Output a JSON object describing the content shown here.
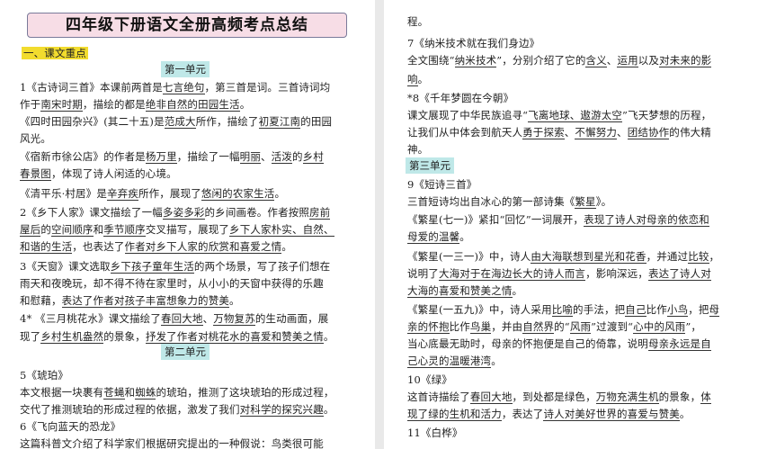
{
  "left_page": {
    "title": "四年级下册语文全册高频考点总结",
    "section_heading": "一、课文重点",
    "unit1": "第一单元",
    "unit2": "第二单元",
    "lines": [
      [
        {
          "t": "1《古诗词三首》本课前两首是"
        },
        {
          "t": "七言绝句",
          "u": true
        },
        {
          "t": "，第三首是词。三首诗词均"
        }
      ],
      [
        {
          "t": "作于"
        },
        {
          "t": "南宋时期",
          "u": true
        },
        {
          "t": "，描绘的都是"
        },
        {
          "t": "绝非自然的田园生活",
          "u": true
        },
        {
          "t": "。"
        }
      ],
      [
        {
          "t": "《四时田园杂兴》(其二十五)是"
        },
        {
          "t": "范成大",
          "u": true
        },
        {
          "t": "所作，描绘了"
        },
        {
          "t": "初夏江南",
          "u": true
        },
        {
          "t": "的田园"
        }
      ],
      [
        {
          "t": "风光。"
        }
      ],
      [
        {
          "t": "《宿新市徐公店》的作者是"
        },
        {
          "t": "杨万里",
          "u": true
        },
        {
          "t": "，描绘了一幅"
        },
        {
          "t": "明丽",
          "u": true
        },
        {
          "t": "、"
        },
        {
          "t": "活泼",
          "u": true
        },
        {
          "t": "的"
        },
        {
          "t": "乡村",
          "u": true
        }
      ],
      [
        {
          "t": "春景图",
          "u": true
        },
        {
          "t": "，体现了诗人闲适的心境。"
        }
      ],
      [
        {
          "t": "《清平乐·村居》是"
        },
        {
          "t": "辛弃疾",
          "u": true
        },
        {
          "t": "所作，展现了"
        },
        {
          "t": "悠闲的农家生活",
          "u": true
        },
        {
          "t": "。"
        }
      ],
      [
        {
          "t": "2《乡下人家》课文描绘了一幅"
        },
        {
          "t": "多姿多彩",
          "u": true
        },
        {
          "t": "的乡间画卷。作者按照"
        },
        {
          "t": "房前",
          "u": true
        }
      ],
      [
        {
          "t": "屋后",
          "u": true
        },
        {
          "t": "的"
        },
        {
          "t": "空间顺序",
          "u": true
        },
        {
          "t": "和"
        },
        {
          "t": "季节顺序",
          "u": true
        },
        {
          "t": "交叉描写，展现了"
        },
        {
          "t": "乡下人家朴实、自然、",
          "u": true
        }
      ],
      [
        {
          "t": "和谐的生活",
          "u": true
        },
        {
          "t": "，也表达了"
        },
        {
          "t": "作者对乡下人家的欣赏和喜爱之情",
          "u": true
        },
        {
          "t": "。"
        }
      ],
      [
        {
          "t": "3《天窗》课文选取"
        },
        {
          "t": "乡下孩子童年生活",
          "u": true
        },
        {
          "t": "的两个场景，写了孩子们想在"
        }
      ],
      [
        {
          "t": "雨天和夜晚玩，却不得不待在家里时，从小小的天窗中获得的乐趣"
        }
      ],
      [
        {
          "t": "和慰藉，"
        },
        {
          "t": "表达了作者对孩子丰富想象力的赞美",
          "u": true
        },
        {
          "t": "。"
        }
      ],
      [
        {
          "t": "4* 《三月桃花水》课文描绘了"
        },
        {
          "t": "春回大地",
          "u": true
        },
        {
          "t": "、"
        },
        {
          "t": "万物复苏",
          "u": true
        },
        {
          "t": "的生动画面，展"
        }
      ],
      [
        {
          "t": "现了"
        },
        {
          "t": "乡村生机盎然",
          "u": true
        },
        {
          "t": "的景象，"
        },
        {
          "t": "抒发了作者对桃花水的喜爱和赞美之情",
          "u": true
        },
        {
          "t": "。"
        }
      ],
      [
        {
          "t": "5《琥珀》"
        }
      ],
      [
        {
          "t": "本文根据一块裹有"
        },
        {
          "t": "苍蝇",
          "u": true
        },
        {
          "t": "和"
        },
        {
          "t": "蜘蛛",
          "u": true
        },
        {
          "t": "的琥珀，推测了这块琥珀的形成过程，"
        }
      ],
      [
        {
          "t": "交代了推测琥珀的形成过程的依据，激发了我们"
        },
        {
          "t": "对科学的探究兴趣",
          "u": true
        },
        {
          "t": "。"
        }
      ],
      [
        {
          "t": "6《飞向蓝天的恐龙》"
        }
      ],
      [
        {
          "t": "这篇"
        },
        {
          "t": "科普文",
          "u": true
        },
        {
          "t": "介绍了科学家们根据研究提出的一种假说："
        },
        {
          "t": "鸟类很可能",
          "u": true
        }
      ]
    ]
  },
  "right_page": {
    "unit3": "第三单元",
    "lines": [
      [
        {
          "t": "程。"
        }
      ],
      [
        {
          "t": "7《纳米技术就在我们身边》"
        }
      ],
      [
        {
          "t": "全文围绕“"
        },
        {
          "t": "纳米技术",
          "u": true
        },
        {
          "t": "”，分别介绍了它的"
        },
        {
          "t": "含义",
          "u": true
        },
        {
          "t": "、"
        },
        {
          "t": "运用",
          "u": true
        },
        {
          "t": "以及"
        },
        {
          "t": "对未来的影",
          "u": true
        }
      ],
      [
        {
          "t": "响",
          "u": true
        },
        {
          "t": "。"
        }
      ],
      [
        {
          "t": "*8《千年梦圆在今朝》"
        }
      ],
      [
        {
          "t": "课文展现了中华民族追寻“"
        },
        {
          "t": "飞离地球、遨游太空",
          "u": true
        },
        {
          "t": "”飞天梦想的历程，"
        }
      ],
      [
        {
          "t": "让我们从中体会到航天人"
        },
        {
          "t": "勇于探索",
          "u": true
        },
        {
          "t": "、"
        },
        {
          "t": "不懈努力",
          "u": true
        },
        {
          "t": "、"
        },
        {
          "t": "团结协作",
          "u": true
        },
        {
          "t": "的伟大精"
        }
      ],
      [
        {
          "t": "神。"
        }
      ],
      [
        {
          "t": "9《短诗三首》"
        }
      ],
      [
        {
          "t": "三首短诗均出自冰心的第一部诗集《"
        },
        {
          "t": "繁星",
          "u": true
        },
        {
          "t": "》。"
        }
      ],
      [
        {
          "t": "《繁星(七一)》紧扣“回忆”一词展开，"
        },
        {
          "t": "表现了诗人对母亲的依恋和",
          "u": true
        }
      ],
      [
        {
          "t": "母爱的温馨",
          "u": true
        },
        {
          "t": "。"
        }
      ],
      [
        {
          "t": "《繁星(一三一)》中，诗人"
        },
        {
          "t": "由大海联想到星光和花香",
          "u": true
        },
        {
          "t": "，并通过"
        },
        {
          "t": "比较",
          "u": true
        },
        {
          "t": "，"
        }
      ],
      [
        {
          "t": "说明了"
        },
        {
          "t": "大海对于在海边长大的诗人而言",
          "u": true
        },
        {
          "t": "，影响深远，"
        },
        {
          "t": "表达了诗人对",
          "u": true
        }
      ],
      [
        {
          "t": "大海的喜爱和赞美之情",
          "u": true
        },
        {
          "t": "。"
        }
      ],
      [
        {
          "t": "《繁星(一五九)》中，诗人采用"
        },
        {
          "t": "比喻",
          "u": true
        },
        {
          "t": "的手法，把"
        },
        {
          "t": "自己",
          "u": true
        },
        {
          "t": "比作"
        },
        {
          "t": "小鸟",
          "u": true
        },
        {
          "t": "，把"
        },
        {
          "t": "母",
          "u": true
        }
      ],
      [
        {
          "t": "亲的怀抱",
          "u": true
        },
        {
          "t": "比作"
        },
        {
          "t": "鸟巢",
          "u": true
        },
        {
          "t": "，并由"
        },
        {
          "t": "自然界",
          "u": true
        },
        {
          "t": "的“"
        },
        {
          "t": "风雨",
          "u": true
        },
        {
          "t": "”过渡到“"
        },
        {
          "t": "心中的风雨",
          "u": true
        },
        {
          "t": "”，"
        }
      ],
      [
        {
          "t": "当心底最无助时，母亲的怀抱便是自己的倚靠，说明"
        },
        {
          "t": "母亲永远是自",
          "u": true
        }
      ],
      [
        {
          "t": "己心灵的温暖港湾",
          "u": true
        },
        {
          "t": "。"
        }
      ],
      [
        {
          "t": "10《绿》"
        }
      ],
      [
        {
          "t": "这首诗描绘了"
        },
        {
          "t": "春回大地",
          "u": true
        },
        {
          "t": "，到处都是绿色，"
        },
        {
          "t": "万物充满生机",
          "u": true
        },
        {
          "t": "的景象，"
        },
        {
          "t": "体",
          "u": true
        }
      ],
      [
        {
          "t": "现了绿的生机和活力",
          "u": true
        },
        {
          "t": "，表达了"
        },
        {
          "t": "诗人对美好世界的喜爱与赞美",
          "u": true
        },
        {
          "t": "。"
        }
      ],
      [
        {
          "t": "11《白桦》"
        }
      ]
    ]
  }
}
